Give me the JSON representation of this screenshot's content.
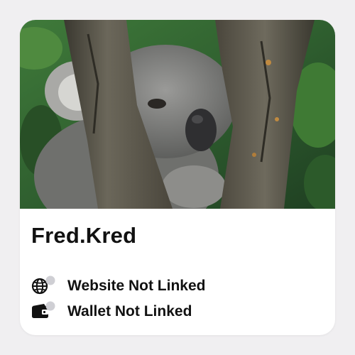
{
  "profile": {
    "name": "Fred.Kred",
    "photo_subject": "koala-in-tree",
    "links": {
      "website": {
        "label": "Website Not Linked",
        "icon": "globe-icon",
        "status_icon": "status-dot-icon"
      },
      "wallet": {
        "label": "Wallet Not Linked",
        "icon": "wallet-icon",
        "status_icon": "status-dot-icon"
      }
    }
  },
  "colors": {
    "page_background": "#f0eff1",
    "card_background": "#ffffff",
    "text": "#111111",
    "status_dot": "#cfcfd4"
  }
}
